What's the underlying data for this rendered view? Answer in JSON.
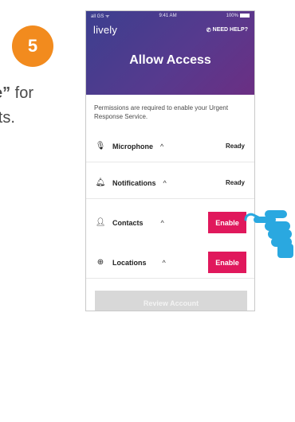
{
  "step": {
    "number": "5"
  },
  "instruction": {
    "bold_part": "e”",
    "line1_rest": " for",
    "line2": "ntacts."
  },
  "status_bar": {
    "signal": "all GS ᯤ",
    "time": "9:41 AM",
    "battery": "100%"
  },
  "header": {
    "logo": "lively",
    "help": "NEED HELP?",
    "title": "Allow Access"
  },
  "description": "Permissions are required to enable your Urgent Response Service.",
  "permissions": [
    {
      "label": "Microphone",
      "icon": "microphone-icon",
      "status": "Ready"
    },
    {
      "label": "Notifications",
      "icon": "bell-icon",
      "status": "Ready"
    },
    {
      "label": "Contacts",
      "icon": "person-icon",
      "action": "Enable"
    },
    {
      "label": "Locations",
      "icon": "location-target-icon",
      "action": "Enable"
    }
  ],
  "footer": {
    "review_label": "Review Account"
  },
  "colors": {
    "step_badge": "#f28b1e",
    "enable_button": "#e0185c",
    "hand": "#2aa8e0",
    "header_start": "#3c3f8f",
    "header_end": "#6b2f83"
  }
}
